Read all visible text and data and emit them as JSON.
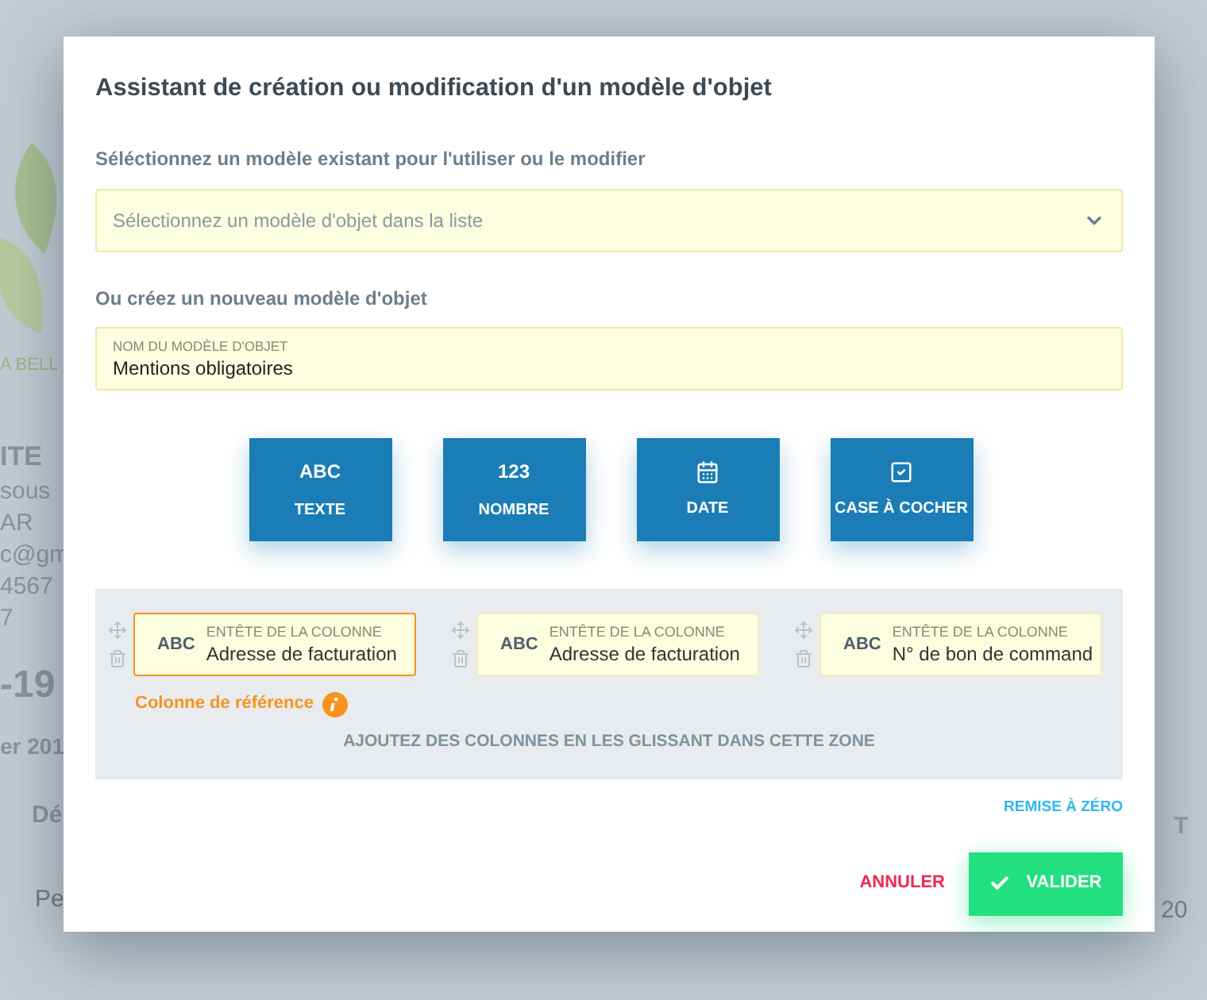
{
  "background": {
    "left_texts": [
      {
        "text": "A BELL",
        "kind": "brand"
      },
      {
        "text": "ITE",
        "kind": "heading"
      },
      {
        "text": "sous",
        "kind": "line"
      },
      {
        "text": "AR",
        "kind": "line"
      },
      {
        "text": "c@gm",
        "kind": "line"
      },
      {
        "text": "4567",
        "kind": "line"
      },
      {
        "text": "7",
        "kind": "line"
      },
      {
        "text": "-19",
        "kind": "big"
      },
      {
        "text": "er 201",
        "kind": "sub"
      },
      {
        "text": "Dé",
        "kind": "th"
      },
      {
        "text": "Pe",
        "kind": "td"
      }
    ],
    "right_texts": [
      {
        "text": "T",
        "kind": "th"
      },
      {
        "text": "20",
        "kind": "td"
      }
    ]
  },
  "dialog": {
    "title": "Assistant de création ou modification d'un modèle d'objet",
    "select_label": "Séléctionnez un modèle existant pour l'utiliser ou le modifier",
    "select": {
      "placeholder": "Sélectionnez un modèle d'objet dans la liste"
    },
    "create_label": "Ou créez un nouveau modèle d'objet",
    "name_field": {
      "label": "NOM DU MODÈLE D'OBJET",
      "value": "Mentions obligatoires"
    },
    "type_buttons": [
      {
        "kind": "text",
        "glyph": "ABC",
        "label": "TEXTE"
      },
      {
        "kind": "number",
        "glyph": "123",
        "label": "NOMBRE"
      },
      {
        "kind": "date",
        "label": "DATE"
      },
      {
        "kind": "checkbox",
        "label": "CASE À COCHER"
      }
    ],
    "columns": [
      {
        "type_label": "ABC",
        "label": "ENTÊTE DE LA COLONNE",
        "value": "Adresse de facturation",
        "selected": true
      },
      {
        "type_label": "ABC",
        "label": "ENTÊTE DE LA COLONNE",
        "value": "Adresse de facturation",
        "selected": false
      },
      {
        "type_label": "ABC",
        "label": "ENTÊTE DE LA COLONNE",
        "value": "N° de bon de command",
        "selected": false
      }
    ],
    "reference_note": "Colonne de référence",
    "drop_hint": "AJOUTEZ DES COLONNES EN LES GLISSANT DANS CETTE ZONE",
    "reset_link": "REMISE À ZÉRO",
    "cancel_button": "ANNULER",
    "confirm_button": "VALIDER"
  }
}
